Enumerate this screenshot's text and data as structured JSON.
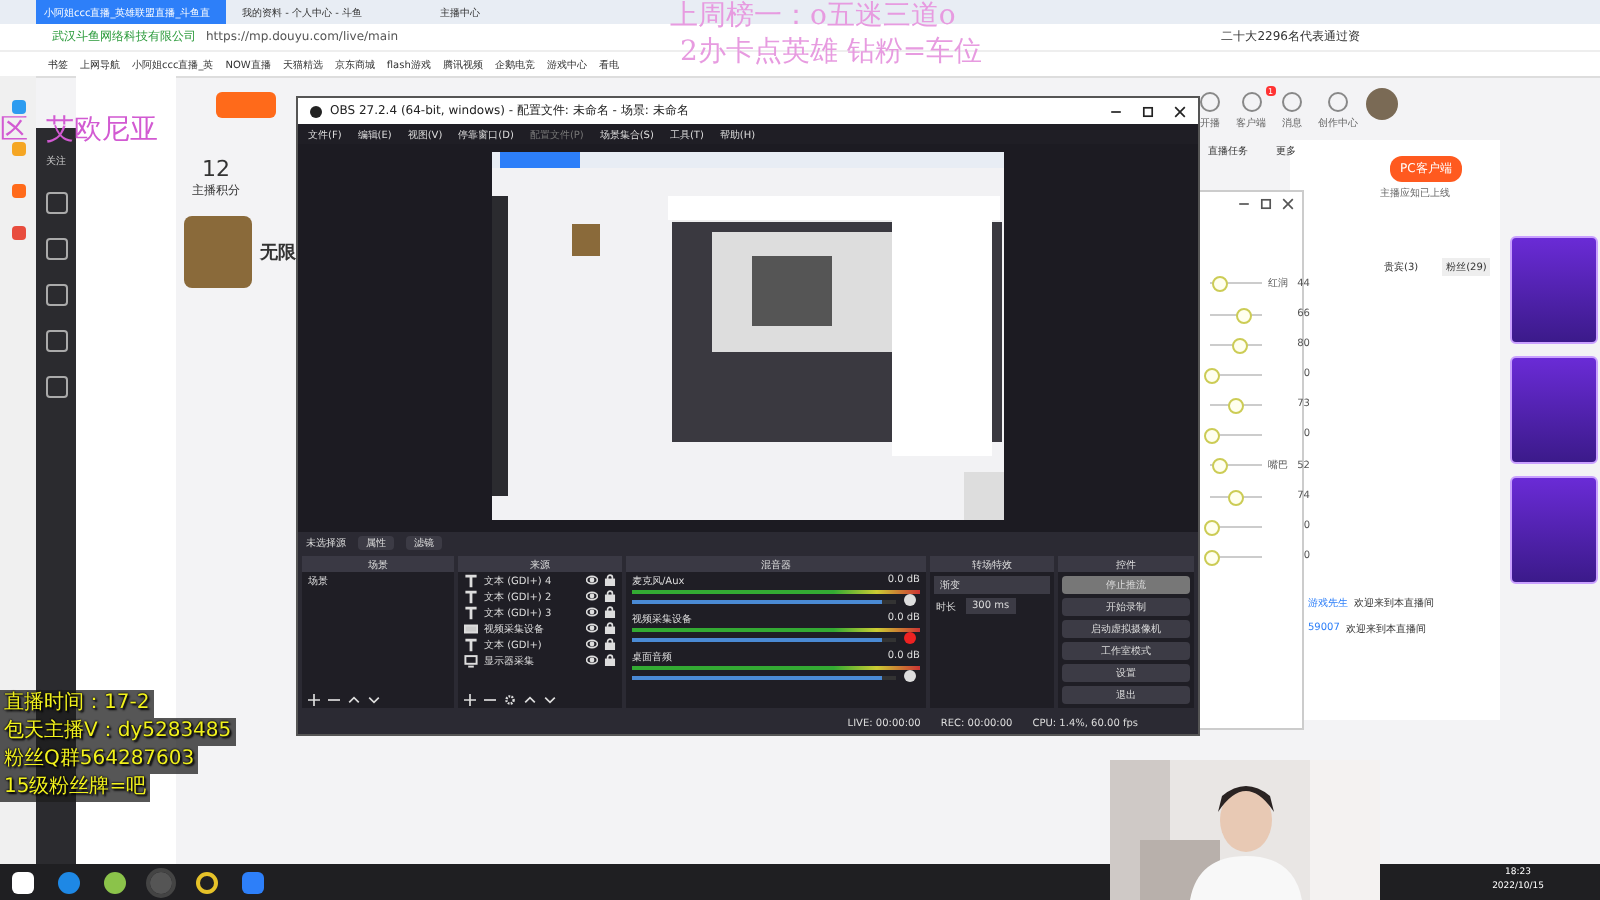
{
  "browser": {
    "tabs": [
      {
        "label": "小阿姐ccc直播_英雄联盟直播_斗鱼直",
        "selected": true
      },
      {
        "label": "我的资料 - 个人中心 - 斗鱼",
        "selected": false
      },
      {
        "label": "主播中心",
        "selected": false
      }
    ],
    "site_name": "武汉斗鱼网络科技有限公司",
    "url": "https://mp.douyu.com/live/main",
    "news": "二十大2296名代表通过资",
    "bookmarks": [
      "书签",
      "上网导航",
      "小阿姐ccc直播_英",
      "NOW直播",
      "天猫精选",
      "京东商城",
      "flash游戏",
      "腾讯视频",
      "企鹅电竞",
      "游戏中心",
      "看电"
    ]
  },
  "page": {
    "nav": [
      "关注"
    ],
    "score": "12",
    "score_label": "主播积分",
    "card_title": "无限",
    "top_links": [
      "开播",
      "客户端",
      "消息",
      "创作中心"
    ],
    "notice_badge": "1",
    "tools": [
      "直播任务",
      "更多"
    ],
    "client_button": "PC客户端",
    "client_hint": "主播应知已上线",
    "chat_tabs": [
      {
        "label": "贵宾(3)",
        "selected": false
      },
      {
        "label": "粉丝(29)",
        "selected": true
      }
    ],
    "chat": [
      {
        "name": "游戏先生",
        "text": "欢迎来到本直播间"
      },
      {
        "name": "59007",
        "text": "欢迎来到本直播间"
      }
    ]
  },
  "overlay": {
    "pink": [
      "上周榜一：o五迷三道o",
      "2办卡点英雄 钻粉=车位"
    ],
    "region": "区  艾欧尼亚",
    "yellow": [
      "直播时间：17-2",
      "包天主播V：dy5283485",
      "粉丝Q群564287603",
      "15级粉丝牌=吧"
    ]
  },
  "beauty": {
    "sliders": [
      {
        "label": "红润",
        "reading": "44",
        "level": 0.15
      },
      {
        "reading": "66",
        "level": 0.6
      },
      {
        "reading": "80",
        "level": 0.55
      },
      {
        "reading": "0",
        "level": 0
      },
      {
        "reading": "73",
        "level": 0.45
      },
      {
        "reading": "0",
        "level": 0
      },
      {
        "label": "嘴巴",
        "reading": "52",
        "level": 0.15
      },
      {
        "reading": "74",
        "level": 0.45
      },
      {
        "reading": "0",
        "level": 0
      },
      {
        "reading": "0",
        "level": 0
      }
    ]
  },
  "obs": {
    "title": "OBS 27.2.4 (64-bit, windows) - 配置文件: 未命名 - 场景: 未命名",
    "menu": [
      {
        "label": "文件(F)",
        "disabled": false
      },
      {
        "label": "编辑(E)",
        "disabled": false
      },
      {
        "label": "视图(V)",
        "disabled": false
      },
      {
        "label": "停靠窗口(D)",
        "disabled": false
      },
      {
        "label": "配置文件(P)",
        "disabled": true
      },
      {
        "label": "场景集合(S)",
        "disabled": false
      },
      {
        "label": "工具(T)",
        "disabled": false
      },
      {
        "label": "帮助(H)",
        "disabled": false
      }
    ],
    "no_source": "未选择源",
    "source_buttons": [
      "属性",
      "滤镜"
    ],
    "docks": [
      "场景",
      "来源",
      "混音器",
      "转场特效",
      "控件"
    ],
    "scenes": [
      "场景"
    ],
    "sources": [
      {
        "kind": "text",
        "name": "文本 (GDI+) 4"
      },
      {
        "kind": "text",
        "name": "文本 (GDI+) 2"
      },
      {
        "kind": "text",
        "name": "文本 (GDI+) 3"
      },
      {
        "kind": "video",
        "name": "视频采集设备"
      },
      {
        "kind": "text",
        "name": "文本 (GDI+)"
      },
      {
        "kind": "display",
        "name": "显示器采集"
      }
    ],
    "mixer": [
      {
        "name": "麦克风/Aux",
        "reading": "0.0 dB",
        "level": 0.95,
        "muted": false
      },
      {
        "name": "视频采集设备",
        "reading": "0.0 dB",
        "level": 0.95,
        "muted": true
      },
      {
        "name": "桌面音频",
        "reading": "0.0 dB",
        "level": 0.95,
        "muted": false
      }
    ],
    "transition": {
      "value": "渐变",
      "duration_label": "时长",
      "duration": "300 ms"
    },
    "controls": [
      {
        "label": "停止推流",
        "selected": true
      },
      {
        "label": "开始录制",
        "selected": false
      },
      {
        "label": "启动虚拟摄像机",
        "selected": false
      },
      {
        "label": "工作室模式",
        "selected": false
      },
      {
        "label": "设置",
        "selected": false
      },
      {
        "label": "退出",
        "selected": false
      }
    ],
    "status": [
      "LIVE: 00:00:00",
      "REC: 00:00:00",
      "CPU: 1.4%, 60.00 fps"
    ]
  },
  "taskbar": {
    "time": "18:23",
    "date": "2022/10/15"
  }
}
